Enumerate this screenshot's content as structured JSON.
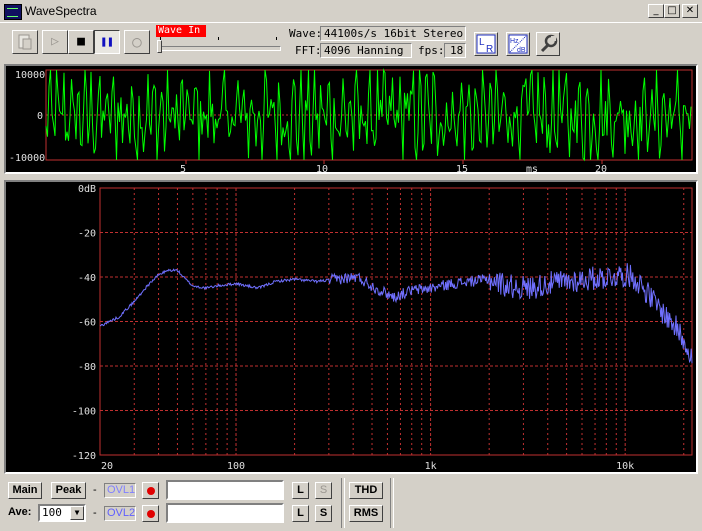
{
  "window": {
    "title": "WaveSpectra"
  },
  "toolbar": {
    "play_icon": "▷",
    "stop_icon": "■",
    "pause_icon": "❚❚",
    "record_icon": "○",
    "input_label": "Wave In",
    "wave_label": "Wave:",
    "wave_value": "44100s/s 16bit Stereo",
    "fft_label": "FFT:",
    "fft_value": "4096 Hanning",
    "fps_label": "fps:",
    "fps_value": "18",
    "lr_icon": "L R",
    "hz_icon_top": "Hz",
    "hz_icon_bottom": "dB"
  },
  "scope": {
    "y_ticks": [
      "10000",
      "0",
      "-10000"
    ],
    "x_ticks": [
      "5",
      "10",
      "15",
      "20"
    ],
    "x_unit": "ms",
    "line_color": "#00ff00"
  },
  "spectrum": {
    "y_ticks": [
      "0dB",
      "-20",
      "-40",
      "-60",
      "-80",
      "-100",
      "-120"
    ],
    "x_ticks": [
      "20",
      "100",
      "1k",
      "10k"
    ],
    "line_color": "#7070ff",
    "grid_color": "#c03030"
  },
  "chart_data": {
    "type": "line",
    "x_scale": "log",
    "xlim": [
      20,
      22050
    ],
    "ylim": [
      -120,
      0
    ],
    "series": [
      {
        "x": [
          20,
          25,
          30,
          35,
          40,
          45,
          50,
          55,
          60,
          70,
          80,
          100,
          130,
          160,
          200,
          260,
          330,
          420,
          520,
          650,
          800,
          1000,
          1300,
          1600,
          2000,
          2500,
          3200,
          4000,
          5000,
          6300,
          8000,
          10000,
          11000,
          12500,
          14000,
          16000,
          18000,
          20000,
          22050
        ],
        "y": [
          -62,
          -58,
          -51,
          -44,
          -39,
          -37,
          -37,
          -41,
          -44,
          -45,
          -44,
          -43,
          -45,
          -42,
          -41,
          -42,
          -41,
          -40,
          -45,
          -49,
          -46,
          -45,
          -43,
          -42,
          -41,
          -44,
          -45,
          -43,
          -42,
          -41,
          -40,
          -39,
          -40,
          -45,
          -51,
          -57,
          -62,
          -68,
          -75
        ]
      }
    ]
  },
  "bottom": {
    "main_label": "Main",
    "peak_label": "Peak",
    "dash": "-",
    "ovl1_label": "OVL1",
    "ovl2_label": "OVL2",
    "ave_label": "Ave:",
    "ave_value": "100",
    "l_label": "L",
    "s_label": "S",
    "thd_label": "THD",
    "rms_label": "RMS"
  }
}
